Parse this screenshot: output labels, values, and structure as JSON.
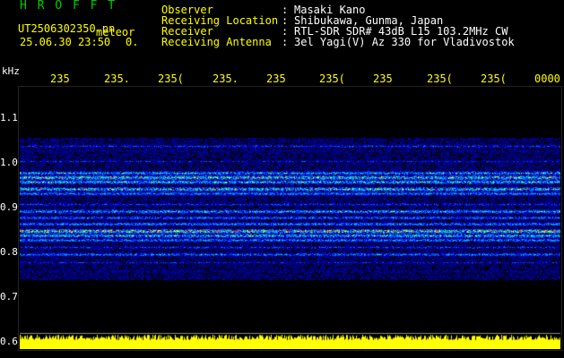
{
  "header": {
    "brand": "H R O F F T",
    "filename": "UT2506302350.pn",
    "meteor_label": "meteor",
    "datetime": "25.06.30 23:50",
    "count": "0.",
    "rows": [
      {
        "label": "Observer",
        "value": "Masaki Kano"
      },
      {
        "label": "Receiving Location",
        "value": "Shibukawa, Gunma, Japan"
      },
      {
        "label": "Receiver",
        "value": "RTL-SDR SDR# 43dB L15 103.2MHz CW"
      },
      {
        "label": "Receiving Antenna",
        "value": "3el Yagi(V) Az 330 for Vladivostok"
      }
    ],
    "colon": ":"
  },
  "axis": {
    "y_unit": "kHz",
    "x_ticks": [
      "235",
      "235.",
      "235(",
      "235.",
      "235",
      "235(",
      "235",
      "235(",
      "235(",
      "0000"
    ],
    "y_ticks": [
      "1.1",
      "1.0",
      "0.9",
      "0.8",
      "0.7",
      "0.6"
    ]
  },
  "colors": {
    "label": "#ffff00",
    "value": "#ffffff",
    "brand": "#00cc00",
    "background": "#000000",
    "power_trace": "#ffff00"
  }
}
